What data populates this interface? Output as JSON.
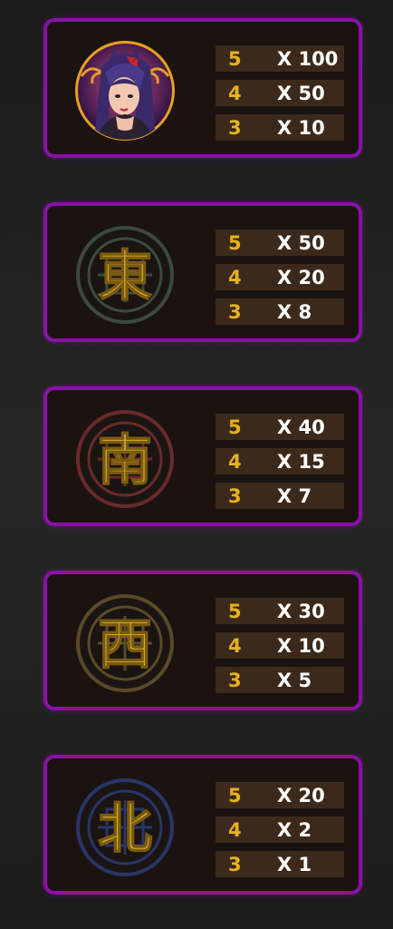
{
  "paytable": [
    {
      "symbol_icon": "geisha-portrait-icon",
      "payouts": [
        {
          "count": "5",
          "multiplier": "X 100"
        },
        {
          "count": "4",
          "multiplier": "X 50"
        },
        {
          "count": "3",
          "multiplier": "X 10"
        }
      ]
    },
    {
      "symbol_icon": "east-character-tile-icon",
      "glyph": "東",
      "ring_color": "#3c4a3e",
      "payouts": [
        {
          "count": "5",
          "multiplier": "X 50"
        },
        {
          "count": "4",
          "multiplier": "X 20"
        },
        {
          "count": "3",
          "multiplier": "X 8"
        }
      ]
    },
    {
      "symbol_icon": "south-character-tile-icon",
      "glyph": "南",
      "ring_color": "#6a2a2a",
      "payouts": [
        {
          "count": "5",
          "multiplier": "X 40"
        },
        {
          "count": "4",
          "multiplier": "X 15"
        },
        {
          "count": "3",
          "multiplier": "X 7"
        }
      ]
    },
    {
      "symbol_icon": "west-character-tile-icon",
      "glyph": "西",
      "ring_color": "#5a4a2a",
      "payouts": [
        {
          "count": "5",
          "multiplier": "X 30"
        },
        {
          "count": "4",
          "multiplier": "X 10"
        },
        {
          "count": "3",
          "multiplier": "X 5"
        }
      ]
    },
    {
      "symbol_icon": "north-character-tile-icon",
      "glyph": "北",
      "ring_color": "#2a3468",
      "payouts": [
        {
          "count": "5",
          "multiplier": "X 20"
        },
        {
          "count": "4",
          "multiplier": "X 2"
        },
        {
          "count": "3",
          "multiplier": "X 1"
        }
      ]
    }
  ],
  "colors": {
    "panel_border": "#8a10a8",
    "count_text": "#e8b21c",
    "multiplier_text": "#ffffff",
    "row_background": "#3b2a1c"
  }
}
